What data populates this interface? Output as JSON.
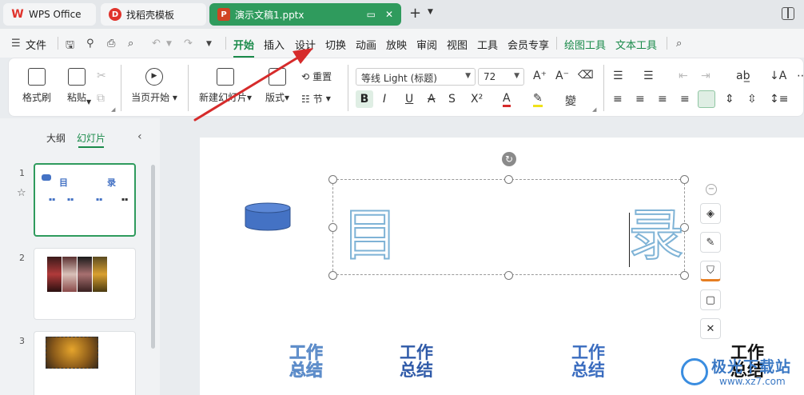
{
  "tabs": [
    {
      "label": "WPS Office"
    },
    {
      "label": "找稻壳模板"
    },
    {
      "label": "演示文稿1.pptx"
    }
  ],
  "menu": {
    "file": "文件",
    "items": [
      "开始",
      "插入",
      "设计",
      "切换",
      "动画",
      "放映",
      "审阅",
      "视图",
      "工具",
      "会员专享"
    ],
    "context_tabs": [
      "绘图工具",
      "文本工具"
    ]
  },
  "ribbon": {
    "format_painter": "格式刷",
    "paste": "粘贴",
    "play_current": "当页开始",
    "new_slide": "新建幻灯片",
    "layout": "版式",
    "reset": "重置",
    "section": "节",
    "font_name": "等线 Light (标题)",
    "font_size": "72"
  },
  "left_panel": {
    "tab_outline": "大纲",
    "tab_slides": "幻灯片",
    "slide_numbers": [
      "1",
      "2",
      "3"
    ],
    "thumb1_title_left": "目",
    "thumb1_title_right": "录"
  },
  "slide": {
    "title_left": "目",
    "title_right": "录",
    "work_label": [
      "工作",
      "总结"
    ]
  },
  "watermark": {
    "text": "极光下载站",
    "url": "www.xz7.com"
  },
  "colors": {
    "accent": "#2f9b5d",
    "cylinder": "#4472c4",
    "hollow_text": "#7fb3d6",
    "arrow": "#d62b2b"
  }
}
